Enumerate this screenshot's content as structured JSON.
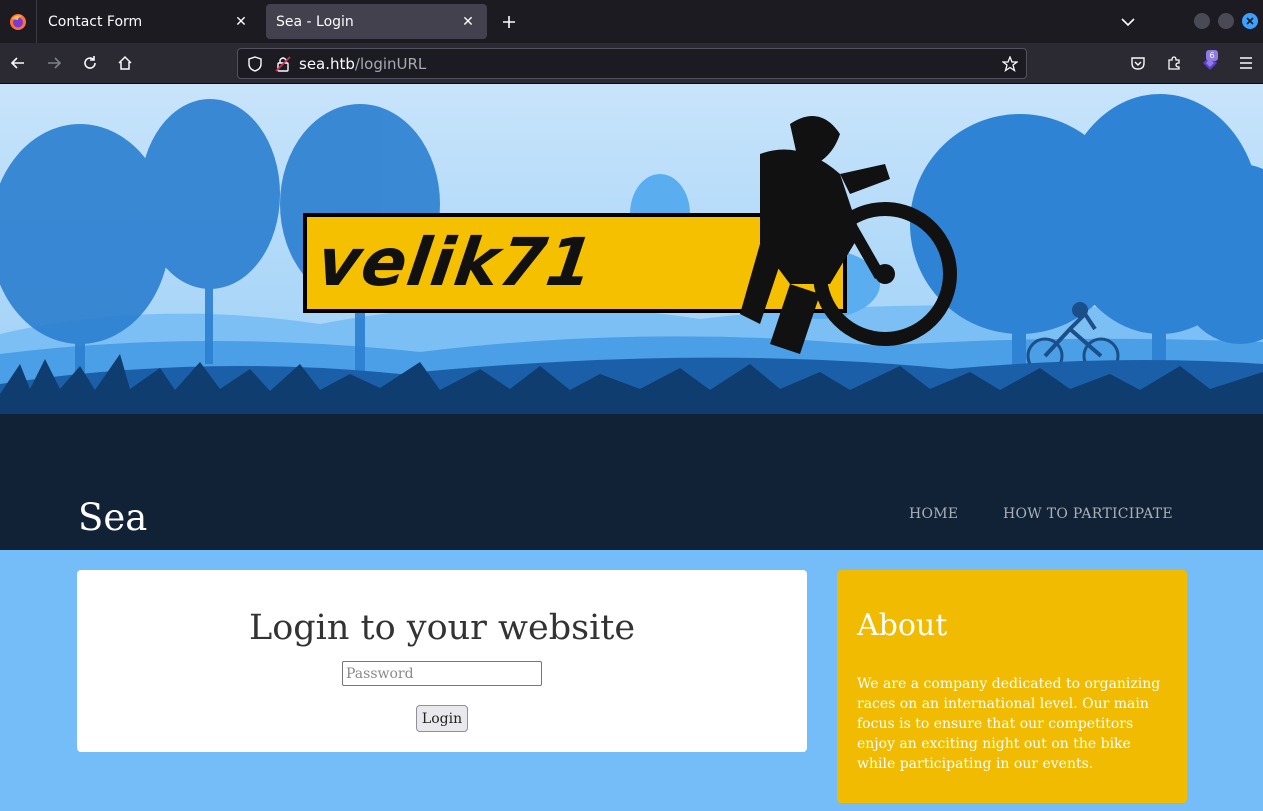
{
  "browser": {
    "tabs": [
      {
        "title": "Contact Form",
        "active": false
      },
      {
        "title": "Sea - Login",
        "active": true
      }
    ],
    "url": {
      "domain": "sea.htb",
      "path": "/loginURL"
    },
    "extensions_badge": "6"
  },
  "banner": {
    "logo_text": "velik71"
  },
  "header": {
    "site_title": "Sea",
    "nav": [
      {
        "label": "HOME"
      },
      {
        "label": "HOW TO PARTICIPATE"
      }
    ]
  },
  "login": {
    "heading": "Login to your website",
    "password_placeholder": "Password",
    "button_label": "Login"
  },
  "about": {
    "heading": "About",
    "text": "We are a company dedicated to organizing races on an international level. Our main focus is to ensure that our competitors enjoy an exciting night out on the bike while participating in our events."
  },
  "colors": {
    "page_bg": "#74bdf9",
    "header_dark": "#122236",
    "about_bg": "#f0bb00",
    "logo_yellow": "#f5c000"
  }
}
